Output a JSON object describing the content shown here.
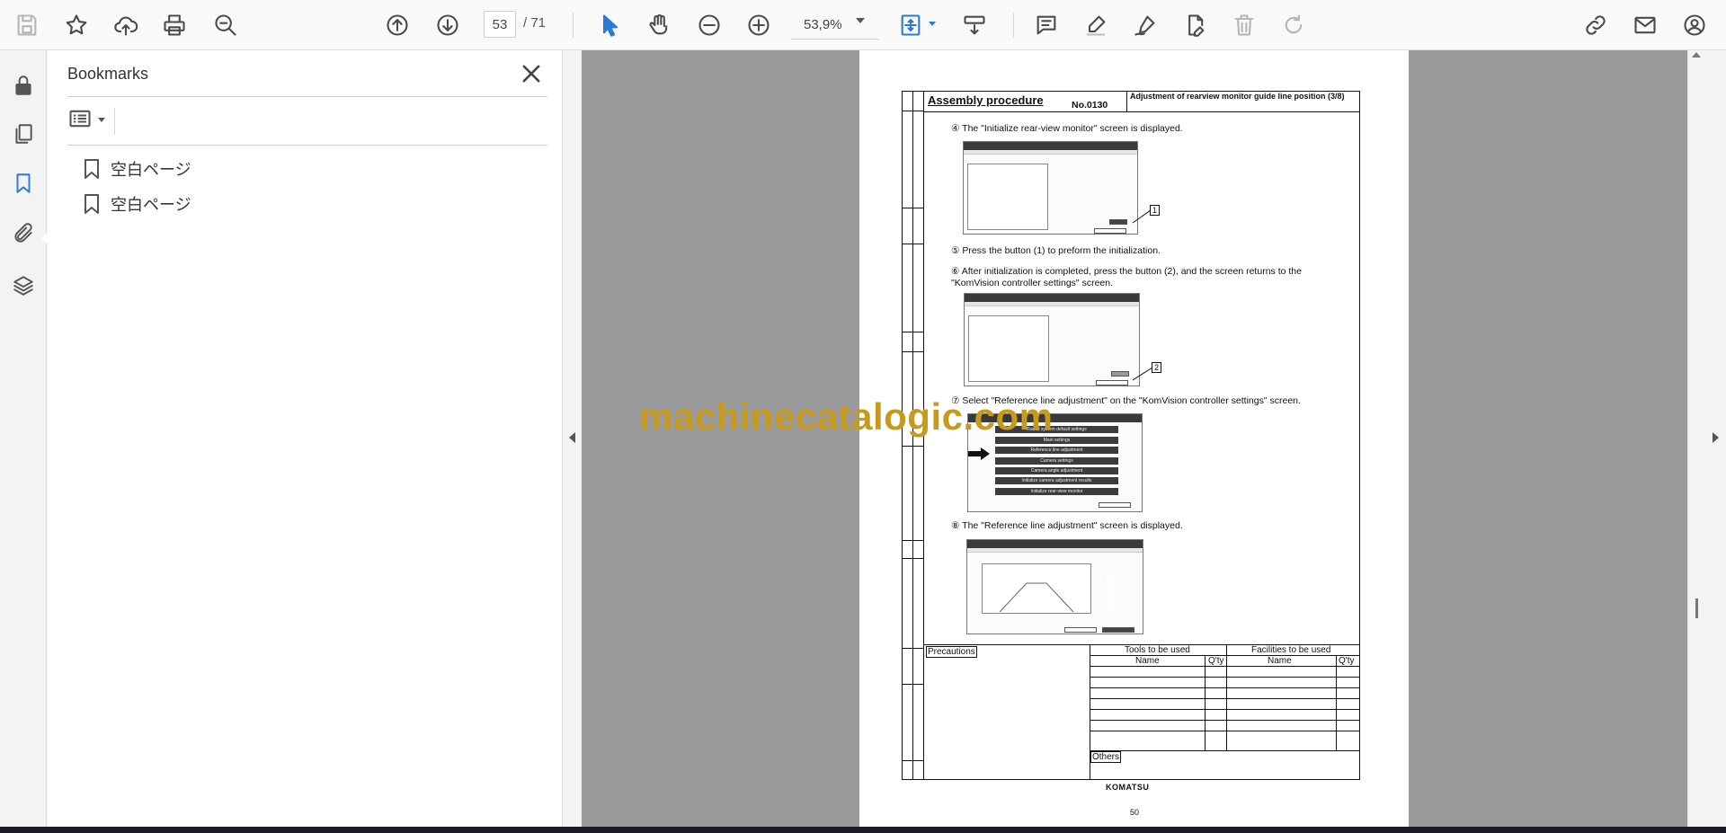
{
  "toolbar": {
    "page_current": "53",
    "page_total": "/ 71",
    "zoom": "53,9%"
  },
  "bookmarks": {
    "title": "Bookmarks",
    "items": [
      {
        "label": "空白ページ"
      },
      {
        "label": "空白ページ"
      }
    ]
  },
  "document": {
    "header_title": "Assembly procedure",
    "header_no": "No.0130",
    "header_right": "Adjustment of rearview monitor guide line position (3/8)",
    "steps": [
      {
        "num": "④",
        "text": "The \"Initialize rear-view monitor\" screen is displayed."
      },
      {
        "num": "⑤",
        "text": "Press the button (1) to preform the initialization."
      },
      {
        "num": "⑥",
        "text": "After initialization is completed, press the button (2), and the screen returns to the \"KomVision controller settings\" screen."
      },
      {
        "num": "⑦",
        "text": "Select \"Reference line adjustment\" on the \"KomVision controller settings\" screen."
      },
      {
        "num": "⑧",
        "text": "The \"Reference line adjustment\" screen is displayed."
      }
    ],
    "callouts": [
      "1",
      "2"
    ],
    "menu_items": [
      "Radial system default settings",
      "Main settings",
      "Reference line adjustment",
      "Camera settings",
      "Camera angle adjustment",
      "Initialize camera adjustment results",
      "Initialize rear-view monitor"
    ],
    "table": {
      "precautions": "Precautions",
      "tools": "Tools to be used",
      "facilities": "Facilities to be used",
      "name": "Name",
      "qty": "Q'ty",
      "others": "Others"
    },
    "brand": "KOMATSU",
    "page_number": "50"
  },
  "watermark": "machinecatalogic.com"
}
